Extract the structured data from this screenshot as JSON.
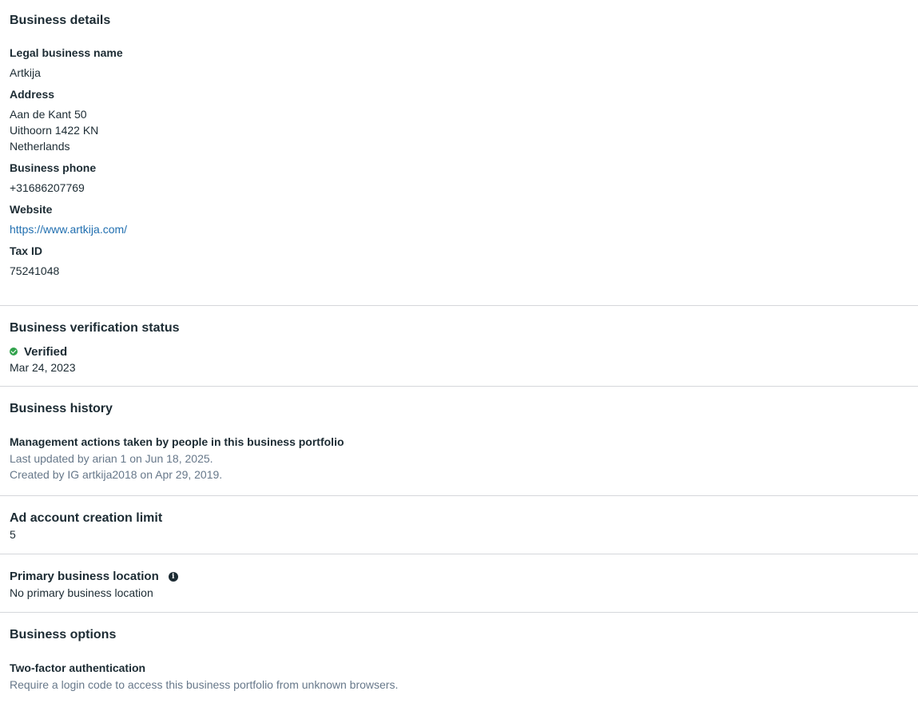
{
  "business_details": {
    "title": "Business details",
    "legal_name_label": "Legal business name",
    "legal_name_value": "Artkija",
    "address_label": "Address",
    "address_line1": "Aan de Kant 50",
    "address_line2": "Uithoorn 1422 KN",
    "address_line3": "Netherlands",
    "phone_label": "Business phone",
    "phone_value": "+31686207769",
    "website_label": "Website",
    "website_value": "https://www.artkija.com/",
    "tax_label": "Tax ID",
    "tax_value": "75241048"
  },
  "verification": {
    "title": "Business verification status",
    "status": "Verified",
    "status_color": "#31a24c",
    "date": "Mar 24, 2023"
  },
  "history": {
    "title": "Business history",
    "label": "Management actions taken by people in this business portfolio",
    "line1": "Last updated by arian 1 on Jun 18, 2025.",
    "line2": "Created by IG artkija2018 on Apr 29, 2019."
  },
  "ad_limit": {
    "title": "Ad account creation limit",
    "value": "5"
  },
  "location": {
    "title": "Primary business location",
    "icon": "info-icon",
    "value": "No primary business location"
  },
  "options": {
    "title": "Business options",
    "two_factor_label": "Two-factor authentication",
    "two_factor_desc": "Require a login code to access this business portfolio from unknown browsers."
  }
}
